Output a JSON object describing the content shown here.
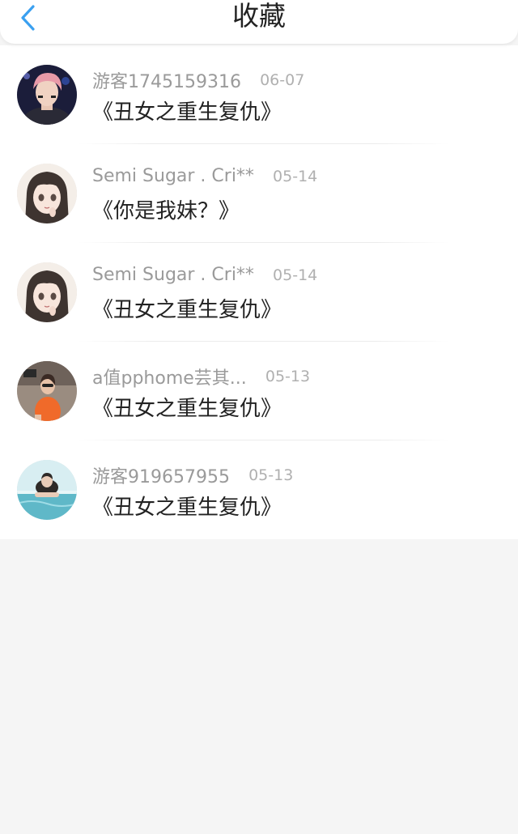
{
  "header": {
    "title": "收藏",
    "back_icon": "chevron-left-icon",
    "accent_color": "#3aa0f0"
  },
  "favorites": [
    {
      "username": "游客1745159316",
      "date": "06-07",
      "book_title": "《丑女之重生复仇》",
      "avatar": "avatar-photo-pink-hair"
    },
    {
      "username": "Semi Sugar . Cri**",
      "date": "05-14",
      "book_title": "《你是我妹？》",
      "avatar": "avatar-anime-girl"
    },
    {
      "username": "Semi Sugar . Cri**",
      "date": "05-14",
      "book_title": "《丑女之重生复仇》",
      "avatar": "avatar-anime-girl"
    },
    {
      "username": "a值pphome芸其...",
      "date": "05-13",
      "book_title": "《丑女之重生复仇》",
      "avatar": "avatar-photo-orange-top"
    },
    {
      "username": "游客919657955",
      "date": "05-13",
      "book_title": "《丑女之重生复仇》",
      "avatar": "avatar-photo-pool"
    }
  ]
}
